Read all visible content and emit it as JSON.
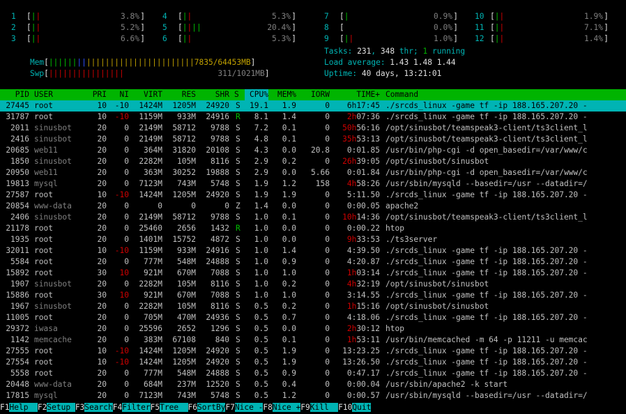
{
  "cpus": [
    {
      "id": "1",
      "bars": "||",
      "val": "3.8%"
    },
    {
      "id": "2",
      "bars": "||",
      "val": "5.2%"
    },
    {
      "id": "3",
      "bars": "||",
      "val": "6.6%"
    },
    {
      "id": "4",
      "bars": "||",
      "val": "5.3%"
    },
    {
      "id": "5",
      "bars": "||||",
      "val": "20.4%"
    },
    {
      "id": "6",
      "bars": "||",
      "val": "5.3%"
    },
    {
      "id": "7",
      "bars": "|",
      "val": "0.9%"
    },
    {
      "id": "8",
      "bars": "",
      "val": "0.0%"
    },
    {
      "id": "9",
      "bars": "||",
      "val": "1.0%"
    },
    {
      "id": "10",
      "bars": "||",
      "val": "1.9%"
    },
    {
      "id": "11",
      "bars": "||",
      "val": "7.1%"
    },
    {
      "id": "12",
      "bars": "||",
      "val": "1.4%"
    }
  ],
  "mem": {
    "label": "Mem",
    "val": "7835/64453MB"
  },
  "swp": {
    "label": "Swp",
    "val": "311/1021MB"
  },
  "tasks": {
    "prefix": "Tasks: ",
    "tasks": "231",
    "sep": ", ",
    "thr": "348",
    "thr_label": " thr; ",
    "running": "1",
    "running_label": " running"
  },
  "load": {
    "prefix": "Load average: ",
    "a": "1.43",
    "b": "1.48",
    "c": "1.44"
  },
  "uptime": {
    "prefix": "Uptime: ",
    "val": "40 days, 13:21:01"
  },
  "header": {
    "pid": "PID",
    "user": "USER",
    "pri": "PRI",
    "ni": "NI",
    "virt": "VIRT",
    "res": "RES",
    "shr": "SHR",
    "s": "S",
    "cpu": "CPU%",
    "mem": "MEM%",
    "iorw": "IORW",
    "time": "TIME+",
    "cmd": "Command"
  },
  "processes": [
    {
      "pid": "27445",
      "user": "root",
      "pri": "10",
      "ni": "-10",
      "virt": "1424M",
      "res": "1205M",
      "shr": "24920",
      "s": "S",
      "cpu": "19.1",
      "mem": "1.9",
      "io": "0",
      "time": "6h17:45",
      "cmd": "./srcds_linux -game tf -ip 188.165.207.20 -"
    },
    {
      "pid": "31787",
      "user": "root",
      "pri": "10",
      "ni": "-10",
      "virt": "1159M",
      "res": "933M",
      "shr": "24916",
      "s": "R",
      "cpu": "8.1",
      "mem": "1.4",
      "io": "0",
      "time": "2h07:36",
      "cmd": "./srcds_linux -game tf -ip 188.165.207.20 -"
    },
    {
      "pid": "2011",
      "user": "sinusbot",
      "pri": "20",
      "ni": "0",
      "virt": "2149M",
      "res": "58712",
      "shr": "9788",
      "s": "S",
      "cpu": "7.2",
      "mem": "0.1",
      "io": "0",
      "time": "50h56:16",
      "cmd": "/opt/sinusbot/teamspeak3-client/ts3client_l"
    },
    {
      "pid": "2416",
      "user": "sinusbot",
      "pri": "20",
      "ni": "0",
      "virt": "2149M",
      "res": "58712",
      "shr": "9788",
      "s": "S",
      "cpu": "4.8",
      "mem": "0.1",
      "io": "0",
      "time": "35h53:13",
      "cmd": "/opt/sinusbot/teamspeak3-client/ts3client_l"
    },
    {
      "pid": "20685",
      "user": "web11",
      "pri": "20",
      "ni": "0",
      "virt": "364M",
      "res": "31820",
      "shr": "20108",
      "s": "S",
      "cpu": "4.3",
      "mem": "0.0",
      "io": "20.8",
      "time": "0:01.85",
      "cmd": "/usr/bin/php-cgi -d open_basedir=/var/www/c"
    },
    {
      "pid": "1850",
      "user": "sinusbot",
      "pri": "20",
      "ni": "0",
      "virt": "2282M",
      "res": "105M",
      "shr": "8116",
      "s": "S",
      "cpu": "2.9",
      "mem": "0.2",
      "io": "0",
      "time": "26h39:05",
      "cmd": "/opt/sinusbot/sinusbot"
    },
    {
      "pid": "20950",
      "user": "web11",
      "pri": "20",
      "ni": "0",
      "virt": "363M",
      "res": "30252",
      "shr": "19888",
      "s": "S",
      "cpu": "2.9",
      "mem": "0.0",
      "io": "5.66",
      "time": "0:01.84",
      "cmd": "/usr/bin/php-cgi -d open_basedir=/var/www/c"
    },
    {
      "pid": "19813",
      "user": "mysql",
      "pri": "20",
      "ni": "0",
      "virt": "7123M",
      "res": "743M",
      "shr": "5748",
      "s": "S",
      "cpu": "1.9",
      "mem": "1.2",
      "io": "158",
      "time": "4h58:26",
      "cmd": "/usr/sbin/mysqld --basedir=/usr --datadir=/"
    },
    {
      "pid": "27587",
      "user": "root",
      "pri": "10",
      "ni": "-10",
      "virt": "1424M",
      "res": "1205M",
      "shr": "24920",
      "s": "S",
      "cpu": "1.9",
      "mem": "1.9",
      "io": "0",
      "time": "5:11.50",
      "cmd": "./srcds_linux -game tf -ip 188.165.207.20 -"
    },
    {
      "pid": "20854",
      "user": "www-data",
      "pri": "20",
      "ni": "0",
      "virt": "0",
      "res": "0",
      "shr": "0",
      "s": "Z",
      "cpu": "1.4",
      "mem": "0.0",
      "io": "0",
      "time": "0:00.05",
      "cmd": "apache2"
    },
    {
      "pid": "2406",
      "user": "sinusbot",
      "pri": "20",
      "ni": "0",
      "virt": "2149M",
      "res": "58712",
      "shr": "9788",
      "s": "S",
      "cpu": "1.0",
      "mem": "0.1",
      "io": "0",
      "time": "10h14:36",
      "cmd": "/opt/sinusbot/teamspeak3-client/ts3client_l"
    },
    {
      "pid": "21178",
      "user": "root",
      "pri": "20",
      "ni": "0",
      "virt": "25460",
      "res": "2656",
      "shr": "1432",
      "s": "R",
      "cpu": "1.0",
      "mem": "0.0",
      "io": "0",
      "time": "0:00.22",
      "cmd": "htop"
    },
    {
      "pid": "1935",
      "user": "root",
      "pri": "20",
      "ni": "0",
      "virt": "1401M",
      "res": "15752",
      "shr": "4872",
      "s": "S",
      "cpu": "1.0",
      "mem": "0.0",
      "io": "0",
      "time": "9h33:53",
      "cmd": "./ts3server"
    },
    {
      "pid": "32011",
      "user": "root",
      "pri": "10",
      "ni": "-10",
      "virt": "1159M",
      "res": "933M",
      "shr": "24916",
      "s": "S",
      "cpu": "1.0",
      "mem": "1.4",
      "io": "0",
      "time": "4:39.50",
      "cmd": "./srcds_linux -game tf -ip 188.165.207.20 -"
    },
    {
      "pid": "5584",
      "user": "root",
      "pri": "20",
      "ni": "0",
      "virt": "777M",
      "res": "548M",
      "shr": "24888",
      "s": "S",
      "cpu": "1.0",
      "mem": "0.9",
      "io": "0",
      "time": "4:20.87",
      "cmd": "./srcds_linux -game tf -ip 188.165.207.20 -"
    },
    {
      "pid": "15892",
      "user": "root",
      "pri": "30",
      "ni": "10",
      "virt": "921M",
      "res": "670M",
      "shr": "7088",
      "s": "S",
      "cpu": "1.0",
      "mem": "1.0",
      "io": "0",
      "time": "1h03:14",
      "cmd": "./srcds_linux -game tf -ip 188.165.207.20 -"
    },
    {
      "pid": "1907",
      "user": "sinusbot",
      "pri": "20",
      "ni": "0",
      "virt": "2282M",
      "res": "105M",
      "shr": "8116",
      "s": "S",
      "cpu": "1.0",
      "mem": "0.2",
      "io": "0",
      "time": "4h32:19",
      "cmd": "/opt/sinusbot/sinusbot"
    },
    {
      "pid": "15886",
      "user": "root",
      "pri": "30",
      "ni": "10",
      "virt": "921M",
      "res": "670M",
      "shr": "7088",
      "s": "S",
      "cpu": "1.0",
      "mem": "1.0",
      "io": "0",
      "time": "3:14.55",
      "cmd": "./srcds_linux -game tf -ip 188.165.207.20 -"
    },
    {
      "pid": "1967",
      "user": "sinusbot",
      "pri": "20",
      "ni": "0",
      "virt": "2282M",
      "res": "105M",
      "shr": "8116",
      "s": "S",
      "cpu": "0.5",
      "mem": "0.2",
      "io": "0",
      "time": "1h15:16",
      "cmd": "/opt/sinusbot/sinusbot"
    },
    {
      "pid": "11005",
      "user": "root",
      "pri": "20",
      "ni": "0",
      "virt": "705M",
      "res": "470M",
      "shr": "24936",
      "s": "S",
      "cpu": "0.5",
      "mem": "0.7",
      "io": "0",
      "time": "4:18.06",
      "cmd": "./srcds_linux -game tf -ip 188.165.207.20 -"
    },
    {
      "pid": "29372",
      "user": "iwasa",
      "pri": "20",
      "ni": "0",
      "virt": "25596",
      "res": "2652",
      "shr": "1296",
      "s": "S",
      "cpu": "0.5",
      "mem": "0.0",
      "io": "0",
      "time": "2h30:12",
      "cmd": "htop"
    },
    {
      "pid": "1142",
      "user": "memcache",
      "pri": "20",
      "ni": "0",
      "virt": "383M",
      "res": "67108",
      "shr": "840",
      "s": "S",
      "cpu": "0.5",
      "mem": "0.1",
      "io": "0",
      "time": "1h53:11",
      "cmd": "/usr/bin/memcached -m 64 -p 11211 -u memcac"
    },
    {
      "pid": "27555",
      "user": "root",
      "pri": "10",
      "ni": "-10",
      "virt": "1424M",
      "res": "1205M",
      "shr": "24920",
      "s": "S",
      "cpu": "0.5",
      "mem": "1.9",
      "io": "0",
      "time": "13:23.25",
      "cmd": "./srcds_linux -game tf -ip 188.165.207.20 -"
    },
    {
      "pid": "27554",
      "user": "root",
      "pri": "10",
      "ni": "-10",
      "virt": "1424M",
      "res": "1205M",
      "shr": "24920",
      "s": "S",
      "cpu": "0.5",
      "mem": "1.9",
      "io": "0",
      "time": "13:26.50",
      "cmd": "./srcds_linux -game tf -ip 188.165.207.20 -"
    },
    {
      "pid": "5558",
      "user": "root",
      "pri": "20",
      "ni": "0",
      "virt": "777M",
      "res": "548M",
      "shr": "24888",
      "s": "S",
      "cpu": "0.5",
      "mem": "0.9",
      "io": "0",
      "time": "0:47.17",
      "cmd": "./srcds_linux -game tf -ip 188.165.207.20 -"
    },
    {
      "pid": "20448",
      "user": "www-data",
      "pri": "20",
      "ni": "0",
      "virt": "684M",
      "res": "237M",
      "shr": "12520",
      "s": "S",
      "cpu": "0.5",
      "mem": "0.4",
      "io": "0",
      "time": "0:00.04",
      "cmd": "/usr/sbin/apache2 -k start"
    },
    {
      "pid": "17815",
      "user": "mysql",
      "pri": "20",
      "ni": "0",
      "virt": "7123M",
      "res": "743M",
      "shr": "5748",
      "s": "S",
      "cpu": "0.5",
      "mem": "1.2",
      "io": "0",
      "time": "0:00.57",
      "cmd": "/usr/sbin/mysqld --basedir=/usr --datadir=/"
    }
  ],
  "footer": [
    {
      "key": "F1",
      "label": "Help  "
    },
    {
      "key": "F2",
      "label": "Setup "
    },
    {
      "key": "F3",
      "label": "Search"
    },
    {
      "key": "F4",
      "label": "Filter"
    },
    {
      "key": "F5",
      "label": "Tree  "
    },
    {
      "key": "F6",
      "label": "SortBy"
    },
    {
      "key": "F7",
      "label": "Nice -"
    },
    {
      "key": "F8",
      "label": "Nice +"
    },
    {
      "key": "F9",
      "label": "Kill  "
    },
    {
      "key": "F10",
      "label": "Quit"
    }
  ],
  "colors": {
    "header_bg": "#00b400",
    "selected_bg": "#00b4b4",
    "accent": "#00b4b4"
  }
}
